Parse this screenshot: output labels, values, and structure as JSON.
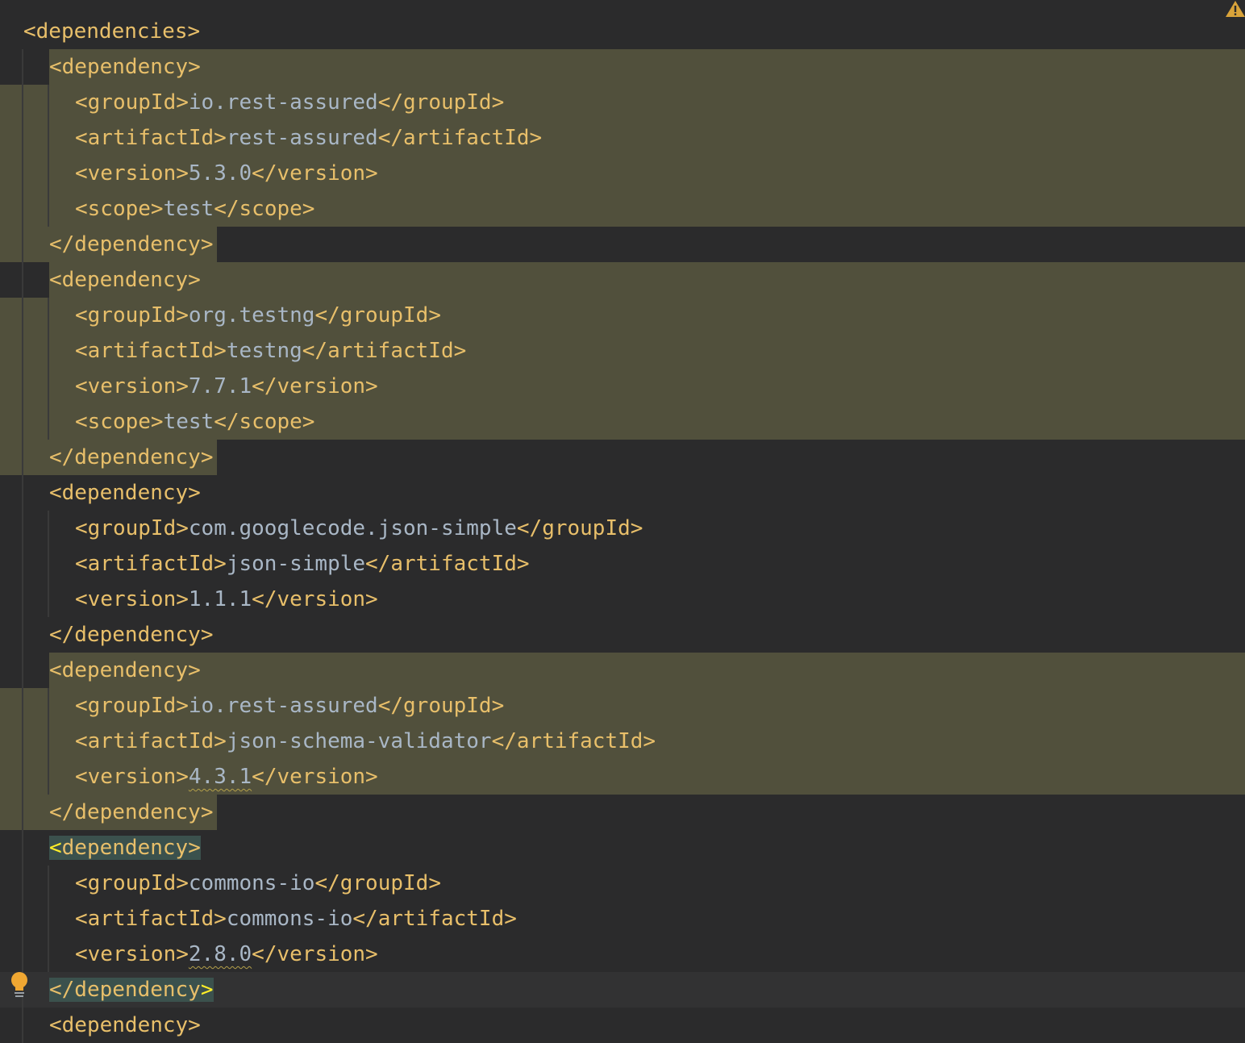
{
  "lines": [
    {
      "indent": 0,
      "open": "<dependencies>",
      "text": "",
      "close": ""
    },
    {
      "indent": 1,
      "open": "<dependency>",
      "text": "",
      "close": "",
      "highlight": true
    },
    {
      "indent": 2,
      "open": "<groupId>",
      "text": "io.rest-assured",
      "close": "</groupId>",
      "highlight": true
    },
    {
      "indent": 2,
      "open": "<artifactId>",
      "text": "rest-assured",
      "close": "</artifactId>",
      "highlight": true
    },
    {
      "indent": 2,
      "open": "<version>",
      "text": "5.3.0",
      "close": "</version>",
      "highlight": true
    },
    {
      "indent": 2,
      "open": "<scope>",
      "text": "test",
      "close": "</scope>",
      "highlight": true
    },
    {
      "indent": 1,
      "open": "</dependency>",
      "text": "",
      "close": "",
      "highlight": true
    },
    {
      "indent": 1,
      "open": "<dependency>",
      "text": "",
      "close": "",
      "highlight": true
    },
    {
      "indent": 2,
      "open": "<groupId>",
      "text": "org.testng",
      "close": "</groupId>",
      "highlight": true
    },
    {
      "indent": 2,
      "open": "<artifactId>",
      "text": "testng",
      "close": "</artifactId>",
      "highlight": true
    },
    {
      "indent": 2,
      "open": "<version>",
      "text": "7.7.1",
      "close": "</version>",
      "highlight": true
    },
    {
      "indent": 2,
      "open": "<scope>",
      "text": "test",
      "close": "</scope>",
      "highlight": true
    },
    {
      "indent": 1,
      "open": "</dependency>",
      "text": "",
      "close": "",
      "highlight": true
    },
    {
      "indent": 1,
      "open": "<dependency>",
      "text": "",
      "close": ""
    },
    {
      "indent": 2,
      "open": "<groupId>",
      "text": "com.googlecode.json-simple",
      "close": "</groupId>"
    },
    {
      "indent": 2,
      "open": "<artifactId>",
      "text": "json-simple",
      "close": "</artifactId>"
    },
    {
      "indent": 2,
      "open": "<version>",
      "text": "1.1.1",
      "close": "</version>"
    },
    {
      "indent": 1,
      "open": "</dependency>",
      "text": "",
      "close": ""
    },
    {
      "indent": 1,
      "open": "<dependency>",
      "text": "",
      "close": "",
      "highlight": true
    },
    {
      "indent": 2,
      "open": "<groupId>",
      "text": "io.rest-assured",
      "close": "</groupId>",
      "highlight": true
    },
    {
      "indent": 2,
      "open": "<artifactId>",
      "text": "json-schema-validator",
      "close": "</artifactId>",
      "highlight": true
    },
    {
      "indent": 2,
      "open": "<version>",
      "text": "4.3.1",
      "close": "</version>",
      "highlight": true,
      "warning": true
    },
    {
      "indent": 1,
      "open": "</dependency>",
      "text": "",
      "close": "",
      "highlight": true
    },
    {
      "indent": 1,
      "open": "<dependency>",
      "text": "",
      "close": "",
      "match": true
    },
    {
      "indent": 2,
      "open": "<groupId>",
      "text": "commons-io",
      "close": "</groupId>"
    },
    {
      "indent": 2,
      "open": "<artifactId>",
      "text": "commons-io",
      "close": "</artifactId>"
    },
    {
      "indent": 2,
      "open": "<version>",
      "text": "2.8.0",
      "close": "</version>",
      "warning": true
    },
    {
      "indent": 1,
      "open": "</dependency>",
      "text": "",
      "close": "",
      "match": true,
      "caret_line": true
    },
    {
      "indent": 1,
      "open": "<dependency>",
      "text": "",
      "close": ""
    }
  ],
  "icons": {
    "top_right": "warning-icon",
    "gutter": "intention-bulb-icon"
  },
  "colors": {
    "background": "#2b2b2c",
    "tag": "#e8bf6a",
    "text": "#a9b7c6",
    "occurrence_highlight": "#51503c",
    "brace_match": "#3b514d",
    "warning": "#d9a33a"
  }
}
